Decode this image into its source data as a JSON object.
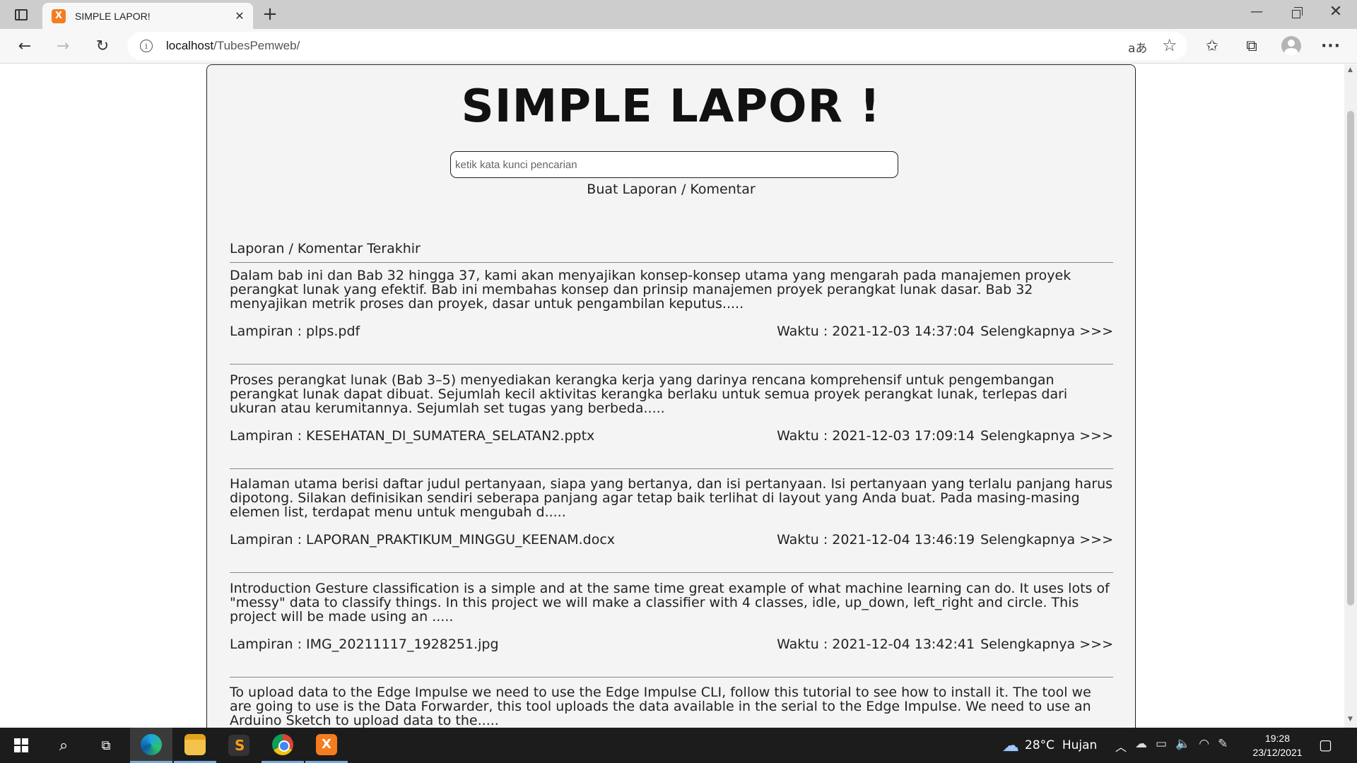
{
  "browser": {
    "tab_title": "SIMPLE LAPOR!",
    "tab_favicon": "X",
    "tab_close": "✕",
    "new_tab": "+",
    "url_host": "localhost",
    "url_path": "/TubesPemweb/",
    "window_controls": {
      "minimize": "—",
      "close": "✕"
    },
    "toolbar_icons": {
      "back": "←",
      "forward": "→",
      "reload": "↻",
      "read_aloud": "aあ",
      "favorite_add": "☆",
      "favorites": "✩",
      "collections": "⧉",
      "more": "···"
    }
  },
  "page": {
    "title": "SIMPLE LAPOR !",
    "search": {
      "placeholder": "ketik kata kunci pencarian",
      "value": ""
    },
    "create_link": "Buat Laporan / Komentar",
    "section_title": "Laporan / Komentar Terakhir",
    "posts": [
      {
        "body": "Dalam bab ini dan Bab 32 hingga 37, kami akan menyajikan konsep-konsep utama yang mengarah pada manajemen proyek perangkat lunak yang efektif. Bab ini membahas konsep dan prinsip manajemen proyek perangkat lunak dasar. Bab 32 menyajikan metrik proses dan proyek, dasar untuk pengambilan keputus.....",
        "attachment": "Lampiran : plps.pdf",
        "time": "Waktu : 2021-12-03 14:37:04",
        "more": "Selengkapnya >>>"
      },
      {
        "body": "Proses perangkat lunak (Bab 3–5) menyediakan kerangka kerja yang darinya rencana komprehensif untuk pengembangan perangkat lunak dapat dibuat. Sejumlah kecil aktivitas kerangka berlaku untuk semua proyek perangkat lunak, terlepas dari ukuran atau kerumitannya. Sejumlah set tugas yang berbeda.....",
        "attachment": "Lampiran : KESEHATAN_DI_SUMATERA_SELATAN2.pptx",
        "time": "Waktu : 2021-12-03 17:09:14",
        "more": "Selengkapnya >>>"
      },
      {
        "body": "Halaman utama berisi daftar judul pertanyaan, siapa yang bertanya, dan isi pertanyaan. Isi pertanyaan yang terlalu panjang harus dipotong. Silakan definisikan sendiri seberapa panjang agar tetap baik terlihat di layout yang Anda buat. Pada masing-masing elemen list, terdapat menu untuk mengubah d.....",
        "attachment": "Lampiran : LAPORAN_PRAKTIKUM_MINGGU_KEENAM.docx",
        "time": "Waktu : 2021-12-04 13:46:19",
        "more": "Selengkapnya >>>"
      },
      {
        "body": "Introduction Gesture classification is a simple and at the same time great example of what machine learning can do. It uses lots of \"messy\" data to classify things. In this project we will make a classifier with 4 classes, idle, up_down, left_right and circle. This project will be made using an .....",
        "attachment": "Lampiran : IMG_20211117_1928251.jpg",
        "time": "Waktu : 2021-12-04 13:42:41",
        "more": "Selengkapnya >>>"
      },
      {
        "body": "To upload data to the Edge Impulse we need to use the Edge Impulse CLI, follow this tutorial to see how to install it. The tool we are going to use is the Data Forwarder, this tool uploads the data available in the serial to the Edge Impulse. We need to use an Arduino Sketch to upload data to the.....",
        "attachment": "",
        "time": "",
        "more": ""
      }
    ]
  },
  "taskbar": {
    "weather": {
      "temp": "28°C",
      "condition": "Hujan",
      "icon": "cloud-rain-icon"
    },
    "clock": {
      "time": "19:28",
      "date": "23/12/2021"
    },
    "apps": [
      "edge",
      "file-explorer",
      "sublime-text",
      "chrome",
      "xampp"
    ]
  },
  "colors": {
    "card_background": "#f4f4f4",
    "tabbar": "#cdcdcd",
    "taskbar": "#1c1c1c",
    "xampp_orange": "#f57c1f"
  }
}
